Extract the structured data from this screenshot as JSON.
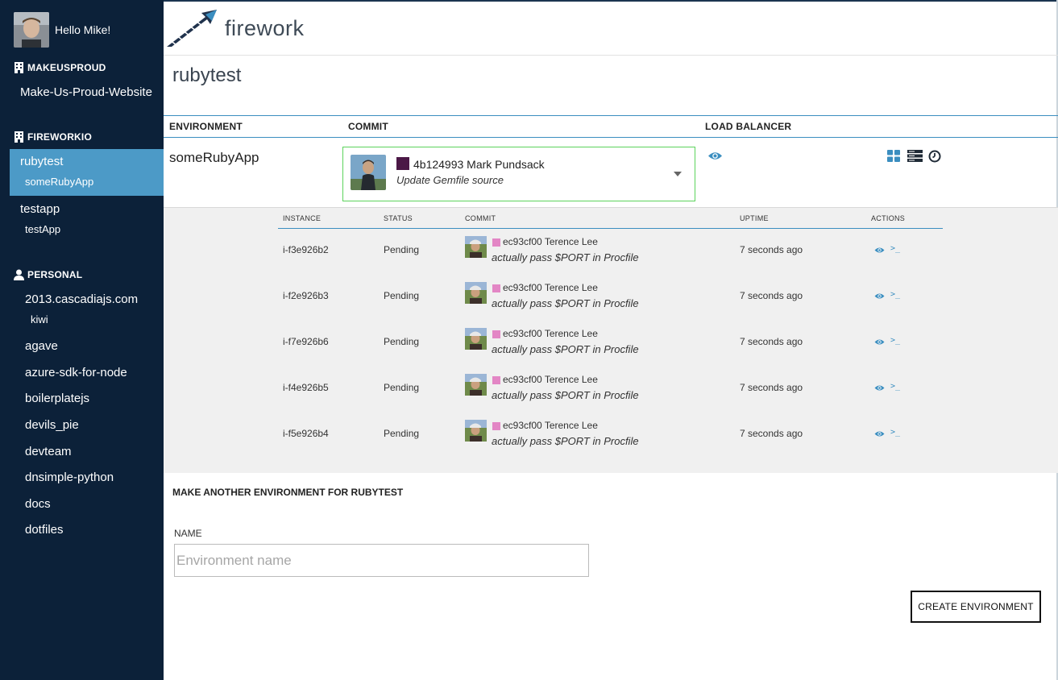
{
  "user": {
    "greeting": "Hello Mike!"
  },
  "sidebar": {
    "orgs": [
      {
        "name": "MAKEUSPROUD",
        "apps": [
          {
            "name": "Make-Us-Proud-Website",
            "envs": []
          }
        ]
      },
      {
        "name": "FIREWORKIO",
        "apps": [
          {
            "name": "rubytest",
            "envs": [
              "someRubyApp"
            ]
          },
          {
            "name": "testapp",
            "envs": [
              "testApp"
            ]
          }
        ]
      },
      {
        "name": "PERSONAL",
        "apps": [
          {
            "name": "2013.cascadiajs.com",
            "envs": [
              "kiwi"
            ]
          },
          {
            "name": "agave",
            "envs": []
          },
          {
            "name": "azure-sdk-for-node",
            "envs": []
          },
          {
            "name": "boilerplatejs",
            "envs": []
          },
          {
            "name": "devils_pie",
            "envs": []
          },
          {
            "name": "devteam",
            "envs": []
          },
          {
            "name": "dnsimple-python",
            "envs": []
          },
          {
            "name": "docs",
            "envs": []
          },
          {
            "name": "dotfiles",
            "envs": []
          }
        ]
      }
    ]
  },
  "brand": {
    "name": "firework"
  },
  "app": {
    "title": "rubytest"
  },
  "env_table": {
    "headers": {
      "environment": "ENVIRONMENT",
      "commit": "COMMIT",
      "load_balancer": "LOAD BALANCER"
    },
    "environment": "someRubyApp",
    "commit": {
      "hash_author": "4b124993 Mark Pundsack",
      "message": "Update Gemfile source",
      "swatch_color": "#4b1846"
    },
    "load_balancer_icon": "eye-icon",
    "action_icons": [
      "grid-icon",
      "server-list-icon",
      "clock-icon"
    ]
  },
  "instances": {
    "headers": {
      "instance": "INSTANCE",
      "status": "STATUS",
      "commit": "COMMIT",
      "uptime": "UPTIME",
      "actions": "ACTIONS"
    },
    "rows": [
      {
        "id": "i-f3e926b2",
        "status": "Pending",
        "commit": "ec93cf00 Terence Lee",
        "message": "actually pass $PORT in Procfile",
        "uptime": "7 seconds ago"
      },
      {
        "id": "i-f2e926b3",
        "status": "Pending",
        "commit": "ec93cf00 Terence Lee",
        "message": "actually pass $PORT in Procfile",
        "uptime": "7 seconds ago"
      },
      {
        "id": "i-f7e926b6",
        "status": "Pending",
        "commit": "ec93cf00 Terence Lee",
        "message": "actually pass $PORT in Procfile",
        "uptime": "7 seconds ago"
      },
      {
        "id": "i-f4e926b5",
        "status": "Pending",
        "commit": "ec93cf00 Terence Lee",
        "message": "actually pass $PORT in Procfile",
        "uptime": "7 seconds ago"
      },
      {
        "id": "i-f5e926b4",
        "status": "Pending",
        "commit": "ec93cf00 Terence Lee",
        "message": "actually pass $PORT in Procfile",
        "uptime": "7 seconds ago"
      }
    ],
    "row_action_icons": [
      "eye-icon",
      "terminal-icon"
    ],
    "terminal_glyph": ">_"
  },
  "create_env": {
    "heading": "MAKE ANOTHER ENVIRONMENT FOR RUBYTEST",
    "name_label": "NAME",
    "name_placeholder": "Environment name",
    "name_value": "",
    "button_label": "CREATE ENVIRONMENT"
  },
  "colors": {
    "sidebar_bg": "#0c2139",
    "active_bg": "#4c9ac7",
    "accent_blue": "#3b8ec0",
    "commit_box_border": "#5cd35c",
    "instance_commit_swatch": "#e386c5"
  }
}
